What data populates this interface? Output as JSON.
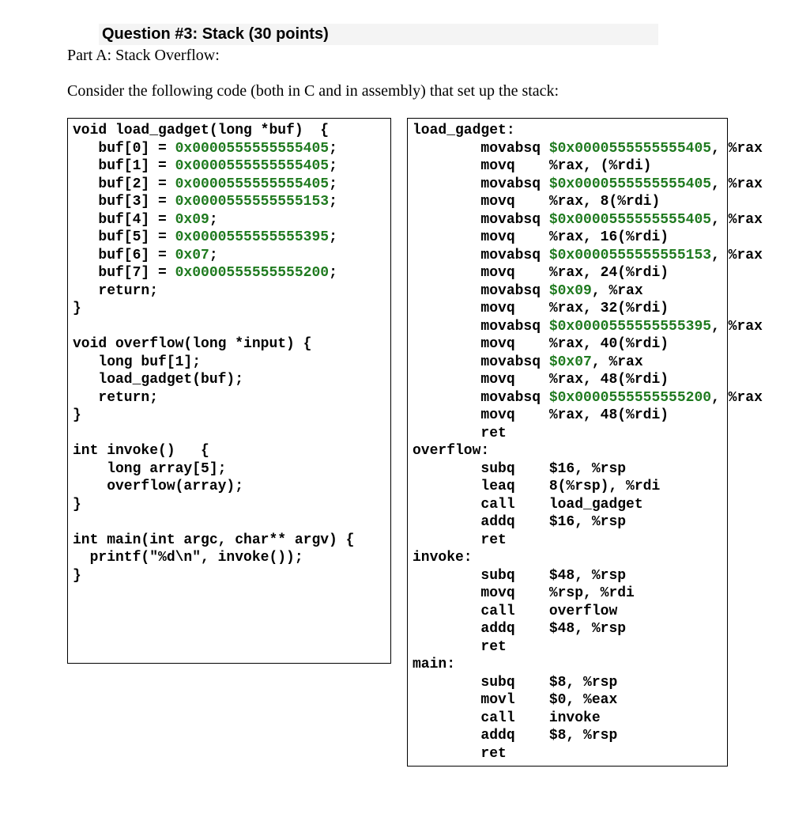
{
  "header": {
    "question_title": "Question #3: Stack (30 points)"
  },
  "part_a": {
    "label": "Part A: Stack Overflow:"
  },
  "intro": {
    "text": "Consider the following code (both in C and in assembly) that set up the stack:"
  },
  "c_code": {
    "line01": "void load_gadget(long *buf)  {",
    "line02a": "   buf[0] = ",
    "line02b": "0x0000555555555405",
    "line02c": ";",
    "line03a": "   buf[1] = ",
    "line03b": "0x0000555555555405",
    "line03c": ";",
    "line04a": "   buf[2] = ",
    "line04b": "0x0000555555555405",
    "line04c": ";",
    "line05a": "   buf[3] = ",
    "line05b": "0x0000555555555153",
    "line05c": ";",
    "line06a": "   buf[4] = ",
    "line06b": "0x09",
    "line06c": ";",
    "line07a": "   buf[5] = ",
    "line07b": "0x0000555555555395",
    "line07c": ";",
    "line08a": "   buf[6] = ",
    "line08b": "0x07",
    "line08c": ";",
    "line09a": "   buf[7] = ",
    "line09b": "0x0000555555555200",
    "line09c": ";",
    "line10": "   return;",
    "line11": "}",
    "blank1": "",
    "line12": "void overflow(long *input) {",
    "line13": "   long buf[1];",
    "line14": "   load_gadget(buf);",
    "line15": "   return;",
    "line16": "}",
    "blank2": "",
    "line17": "int invoke()   {",
    "line18": "    long array[5];",
    "line19": "    overflow(array);",
    "line20": "}",
    "blank3": "",
    "line21": "int main(int argc, char** argv) {",
    "line22": "  printf(\"%d\\n\", invoke());",
    "line23": "}"
  },
  "asm_code": {
    "l01": "load_gadget:",
    "l02a": "        movabsq ",
    "l02b": "$0x0000555555555405",
    "l02c": ", %rax",
    "l03": "        movq    %rax, (%rdi)",
    "l04a": "        movabsq ",
    "l04b": "$0x0000555555555405",
    "l04c": ", %rax",
    "l05": "        movq    %rax, 8(%rdi)",
    "l06a": "        movabsq ",
    "l06b": "$0x0000555555555405",
    "l06c": ", %rax",
    "l07": "        movq    %rax, 16(%rdi)",
    "l08a": "        movabsq ",
    "l08b": "$0x0000555555555153",
    "l08c": ", %rax",
    "l09": "        movq    %rax, 24(%rdi)",
    "l10a": "        movabsq ",
    "l10b": "$0x09",
    "l10c": ", %rax",
    "l11": "        movq    %rax, 32(%rdi)",
    "l12a": "        movabsq ",
    "l12b": "$0x0000555555555395",
    "l12c": ", %rax",
    "l13": "        movq    %rax, 40(%rdi)",
    "l14a": "        movabsq ",
    "l14b": "$0x07",
    "l14c": ", %rax",
    "l15": "        movq    %rax, 48(%rdi)",
    "l16a": "        movabsq ",
    "l16b": "$0x0000555555555200",
    "l16c": ", %rax",
    "l17": "        movq    %rax, 48(%rdi)",
    "l18": "        ret",
    "l19": "overflow:",
    "l20": "        subq    $16, %rsp",
    "l21": "        leaq    8(%rsp), %rdi",
    "l22": "        call    load_gadget",
    "l23": "        addq    $16, %rsp",
    "l24": "        ret",
    "l25": "invoke:",
    "l26": "        subq    $48, %rsp",
    "l27": "        movq    %rsp, %rdi",
    "l28": "        call    overflow",
    "l29": "        addq    $48, %rsp",
    "l30": "        ret",
    "l31": "main:",
    "l32": "        subq    $8, %rsp",
    "l33": "        movl    $0, %eax",
    "l34": "        call    invoke",
    "l35": "        addq    $8, %rsp",
    "l36": "        ret"
  }
}
